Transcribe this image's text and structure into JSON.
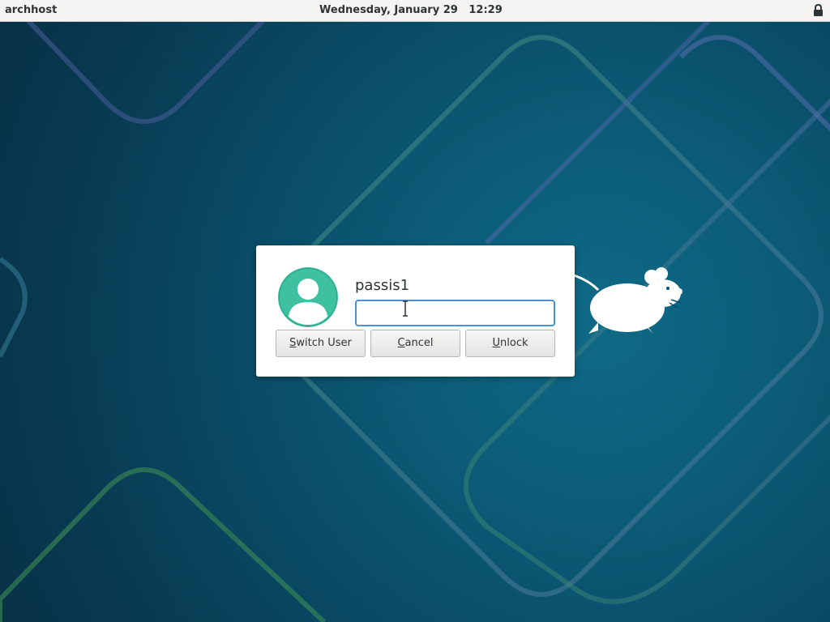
{
  "topbar": {
    "hostname": "archhost",
    "date": "Wednesday, January 29",
    "time": "12:29",
    "lock_icon": "padlock-icon"
  },
  "dialog": {
    "username": "passis1",
    "password_value": "",
    "avatar_icon": "user-avatar-icon",
    "buttons": {
      "switch_user": {
        "mnemonic": "S",
        "rest": "witch User"
      },
      "cancel": {
        "mnemonic": "C",
        "rest": "ancel"
      },
      "unlock": {
        "mnemonic": "U",
        "rest": "nlock"
      }
    }
  },
  "wallpaper": {
    "mascot_icon": "xfce-mouse-icon"
  },
  "colors": {
    "background": "#0a4d68",
    "topbar": "#f5f4f3",
    "focus_border": "#4a90d9",
    "avatar_bg": "#3ec1a0"
  }
}
